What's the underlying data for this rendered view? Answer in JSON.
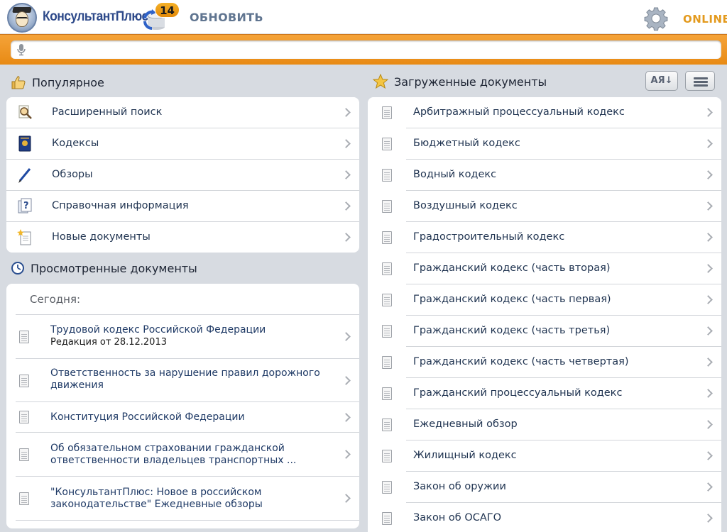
{
  "header": {
    "brand": "КонсультантПлюс",
    "badge_count": "14",
    "update_label": "ОБНОВИТЬ",
    "status": "ONLINE"
  },
  "search": {
    "value": "",
    "placeholder": ""
  },
  "popular": {
    "title": "Популярное",
    "items": [
      {
        "label": "Расширенный поиск",
        "icon": "magnifier-document-icon"
      },
      {
        "label": "Кодексы",
        "icon": "codex-book-icon"
      },
      {
        "label": "Обзоры",
        "icon": "pen-icon"
      },
      {
        "label": "Справочная информация",
        "icon": "help-document-icon"
      },
      {
        "label": "Новые документы",
        "icon": "new-document-icon"
      }
    ]
  },
  "viewed": {
    "title": "Просмотренные документы",
    "group_label": "Сегодня:",
    "items": [
      {
        "title": "Трудовой кодекс Российской Федерации",
        "subtitle": "Редакция от 28.12.2013"
      },
      {
        "title": "Ответственность за нарушение правил дорожного движения",
        "subtitle": ""
      },
      {
        "title": "Конституция Российской Федерации",
        "subtitle": ""
      },
      {
        "title": "Об обязательном страховании гражданской ответственности владельцев транспортных ...",
        "subtitle": ""
      },
      {
        "title": "\"КонсультантПлюс: Новое в российском законодательстве\" Ежедневные обзоры",
        "subtitle": ""
      }
    ]
  },
  "loaded": {
    "title": "Загруженные документы",
    "sort_label": "АЯ↓",
    "items": [
      "Арбитражный процессуальный кодекс",
      "Бюджетный кодекс",
      "Водный кодекс",
      "Воздушный кодекс",
      "Градостроительный кодекс",
      "Гражданский кодекс (часть вторая)",
      "Гражданский кодекс (часть первая)",
      "Гражданский кодекс (часть третья)",
      "Гражданский кодекс (часть четвертая)",
      "Гражданский процессуальный кодекс",
      "Ежедневный обзор",
      "Жилищный кодекс",
      "Закон об оружии",
      "Закон об ОСАГО"
    ]
  },
  "colors": {
    "accent": "#e88a14",
    "online": "#e39a1e",
    "link": "#1f3a66"
  }
}
